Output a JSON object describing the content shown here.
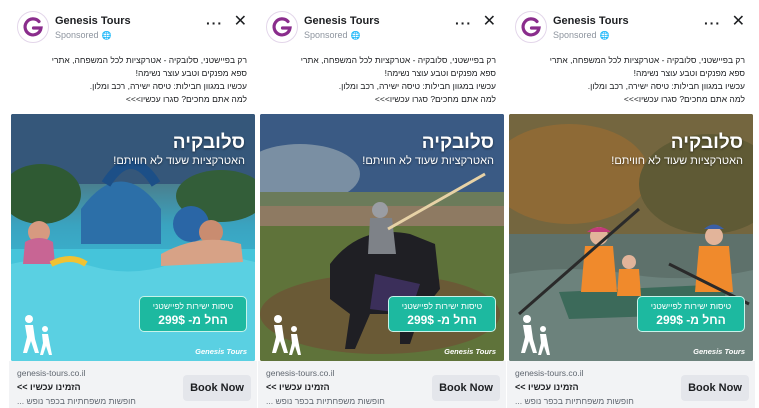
{
  "ads": [
    {
      "advertiser": "Genesis Tours",
      "sponsored": "Sponsored",
      "globe": "🌐",
      "more": "···",
      "close": "✕",
      "primary_text": [
        "רק בפיישטני, סלובקיה - אטרקציות לכל המשפחה, אתרי",
        "ספא מפנקים וטבע עוצר נשימה!",
        "עכשיו במגוון חבילות: טיסה ישירה, רכב ומלון.",
        "למה אתם מחכים? סגרו עכשיו>>>"
      ],
      "media": {
        "title": "סלובקיה",
        "subtitle": "האטרקציות שעוד לא חוויתם!",
        "offer_line1": "טיסות ישירות לפיישטני",
        "offer_line2": "החל מ- 299$",
        "brand": "Genesis Tours",
        "scene": "waterpark"
      },
      "footer": {
        "domain": "genesis-tours.co.il",
        "headline": "הזמינו עכשיו >>",
        "description": "חופשות משפחתיות בכפר נופש ...",
        "cta": "Book Now"
      }
    },
    {
      "advertiser": "Genesis Tours",
      "sponsored": "Sponsored",
      "globe": "🌐",
      "more": "···",
      "close": "✕",
      "primary_text": [
        "רק בפיישטני, סלובקיה - אטרקציות לכל המשפחה, אתרי",
        "ספא מפנקים וטבע עוצר נשימה!",
        "עכשיו במגוון חבילות: טיסה ישירה, רכב ומלון.",
        "למה אתם מחכים? סגרו עכשיו>>>"
      ],
      "media": {
        "title": "סלובקיה",
        "subtitle": "האטרקציות שעוד לא חוויתם!",
        "offer_line1": "טיסות ישירות לפיישטני",
        "offer_line2": "החל מ- 299$",
        "brand": "Genesis Tours",
        "scene": "knight"
      },
      "footer": {
        "domain": "genesis-tours.co.il",
        "headline": "הזמינו עכשיו >>",
        "description": "חופשות משפחתיות בכפר נופש ...",
        "cta": "Book Now"
      }
    },
    {
      "advertiser": "Genesis Tours",
      "sponsored": "Sponsored",
      "globe": "🌐",
      "more": "···",
      "close": "✕",
      "primary_text": [
        "רק בפיישטני, סלובקיה - אטרקציות לכל המשפחה, אתרי",
        "ספא מפנקים וטבע עוצר נשימה!",
        "עכשיו במגוון חבילות: טיסה ישירה, רכב ומלון.",
        "למה אתם מחכים? סגרו עכשיו>>>"
      ],
      "media": {
        "title": "סלובקיה",
        "subtitle": "האטרקציות שעוד לא חוויתם!",
        "offer_line1": "טיסות ישירות לפיישטני",
        "offer_line2": "החל מ- 299$",
        "brand": "Genesis Tours",
        "scene": "canoe"
      },
      "footer": {
        "domain": "genesis-tours.co.il",
        "headline": "הזמינו עכשיו >>",
        "description": "חופשות משפחתיות בכפר נופש ...",
        "cta": "Book Now"
      }
    }
  ],
  "colors": {
    "brand_purple": "#8a2d8c",
    "offer_teal": "#1db9a0",
    "cta_gray": "#e4e6eb",
    "footer_gray": "#f2f3f5"
  },
  "icons": {
    "logo": "genesis-g-logo-icon",
    "more": "more-options-icon",
    "close": "close-icon",
    "globe": "globe-icon",
    "hikers": "hikers-logo-icon"
  }
}
